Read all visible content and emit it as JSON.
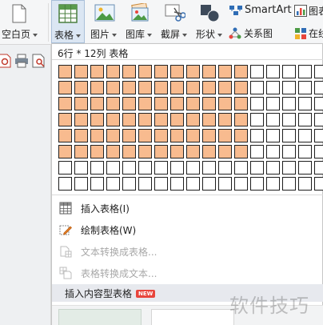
{
  "ribbon": {
    "blank_page_label": "空白页",
    "table_label": "表格",
    "picture_label": "图片",
    "gallery_label": "图库",
    "screenshot_label": "截屏",
    "shapes_label": "形状",
    "smartart_label": "SmartArt",
    "chart_label": "图表",
    "relation_label": "关系图",
    "online_label": "在线"
  },
  "table_dropdown": {
    "grid_caption": "6行 * 12列 表格",
    "grid": {
      "rows": 8,
      "cols": 17,
      "selected_rows": 6,
      "selected_cols": 12
    },
    "menu": [
      {
        "label": "插入表格(I)",
        "icon": "table-grid-icon",
        "enabled": true
      },
      {
        "label": "绘制表格(W)",
        "icon": "draw-table-pencil-icon",
        "enabled": true
      },
      {
        "label": "文本转换成表格...",
        "icon": "text-to-table-icon",
        "enabled": false
      },
      {
        "label": "表格转换成文本...",
        "icon": "table-to-text-icon",
        "enabled": false
      },
      {
        "label": "插入内容型表格",
        "badge": "NEW",
        "enabled": true
      }
    ]
  },
  "watermark": "软件技巧",
  "colors": {
    "selected_cell": "#f8bb8f",
    "active_button_bg": "#dbe6f3",
    "new_badge": "#e8453c"
  }
}
